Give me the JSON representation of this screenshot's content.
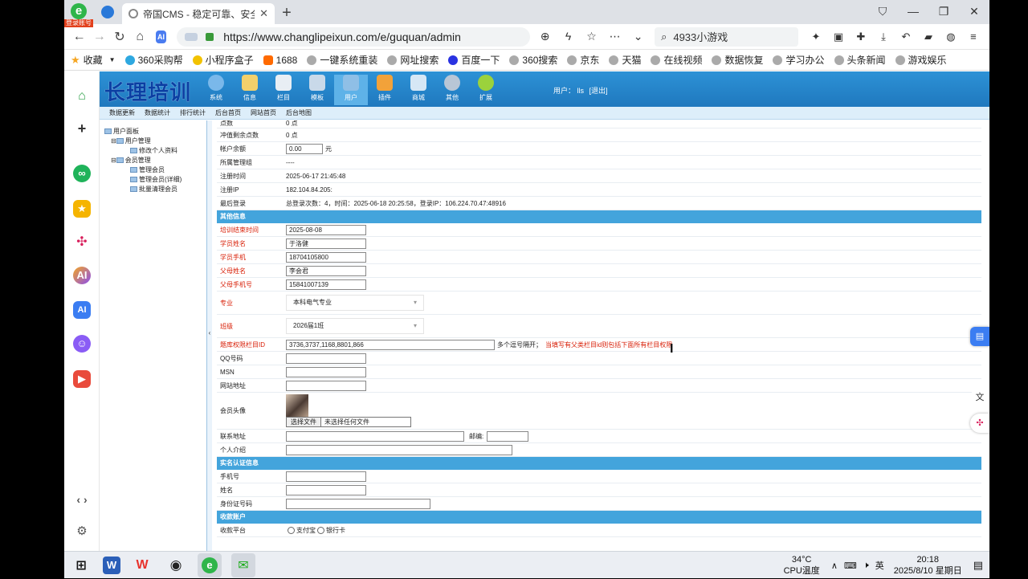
{
  "browser": {
    "login_badge": "登录账号",
    "tab_title": "帝国CMS - 稳定可靠、安全省心",
    "url": "https://www.changlipeixun.com/e/guquan/admin",
    "search_text": "4933小游戏",
    "bookmarks": [
      "收藏",
      "360采购帮",
      "小程序盒子",
      "1688",
      "一键系统重装",
      "网址搜索",
      "百度一下",
      "360搜索",
      "京东",
      "天猫",
      "在线视频",
      "数据恢复",
      "学习办公",
      "头条新闻",
      "游戏娱乐"
    ]
  },
  "cms": {
    "brand": "长理培训",
    "menus": [
      "系统",
      "信息",
      "栏目",
      "模板",
      "用户",
      "插件",
      "商城",
      "其他",
      "扩展"
    ],
    "user_label": "用户：",
    "user_name": "lls",
    "logout": "[退出]",
    "subnav": [
      "数据更新",
      "数据统计",
      "排行统计",
      "后台首页",
      "网站首页",
      "后台地图"
    ],
    "tree": {
      "root": "用户面板",
      "group1": "用户管理",
      "group1_items": [
        "修改个人资料"
      ],
      "group2": "会员管理",
      "group2_items": [
        "管理会员",
        "管理会员(详细)",
        "批量清理会员"
      ]
    }
  },
  "form": {
    "top_rows": [
      {
        "label": "点数",
        "value": "0 点"
      },
      {
        "label": "冲值剩余点数",
        "value": "0 点"
      }
    ],
    "balance_label": "帐户余额",
    "balance_value": "0.00",
    "balance_unit": "元",
    "info_rows": [
      {
        "label": "所属管理组",
        "value": "----"
      },
      {
        "label": "注册时间",
        "value": "2025-06-17 21:45:48"
      },
      {
        "label": "注册IP",
        "value": "182.104.84.205:"
      },
      {
        "label": "最后登录",
        "value": "总登录次数：4，时间：2025-06-18 20:25:58，登录IP：106.224.70.47:48916"
      }
    ],
    "section_other": "其他信息",
    "red_fields": [
      {
        "label": "培训结束时间",
        "value": "2025-08-08"
      },
      {
        "label": "学员姓名",
        "value": "于洛健"
      },
      {
        "label": "学员手机",
        "value": "18704105800"
      },
      {
        "label": "父母姓名",
        "value": "李会君"
      },
      {
        "label": "父母手机号",
        "value": "15841007139"
      }
    ],
    "major_label": "专业",
    "major_value": "本科电气专业",
    "class_label": "班级",
    "class_value": "2026届1班",
    "perm_label": "题库权限栏目ID",
    "perm_value": "3736,3737,1168,8801,866",
    "perm_hint": "多个逗号隔开；",
    "perm_note": "当填写有父类栏目id则包括下面所有栏目权限",
    "plain_fields": [
      "QQ号码",
      "MSN",
      "网站地址"
    ],
    "avatar_label": "会员头像",
    "file_button": "选择文件",
    "file_status": "未选择任何文件",
    "address_label": "联系地址",
    "zip_label": "邮编:",
    "intro_label": "个人介绍",
    "section_realname": "实名认证信息",
    "realname_fields": [
      "手机号",
      "姓名",
      "身份证号码"
    ],
    "section_account": "收款账户",
    "pay_label": "收款平台",
    "pay_options": [
      "支付宝",
      "银行卡"
    ]
  },
  "taskbar": {
    "temp": "34°C",
    "cpu": "CPU温度",
    "lang": "英",
    "time": "20:18",
    "date": "2025/8/10 星期日"
  }
}
